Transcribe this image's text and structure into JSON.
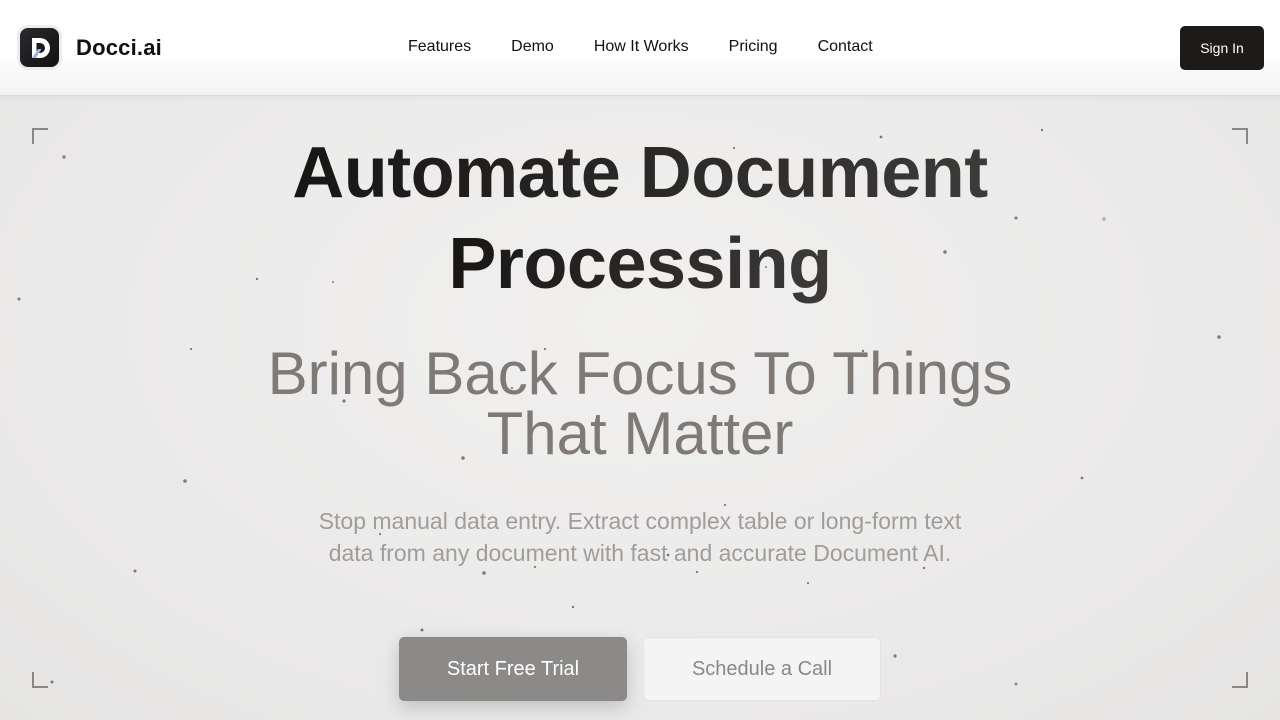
{
  "brand": {
    "name": "Docci.ai",
    "logo_icon": "docci-d-logo-icon"
  },
  "nav": {
    "items": [
      {
        "label": "Features"
      },
      {
        "label": "Demo"
      },
      {
        "label": "How It Works"
      },
      {
        "label": "Pricing"
      },
      {
        "label": "Contact"
      }
    ],
    "signin_label": "Sign In"
  },
  "hero": {
    "headline_line1": "Automate Document",
    "headline_line2": "Processing",
    "subhead_line1": "Bring Back Focus To Things",
    "subhead_line2": "That Matter",
    "desc_line1": "Stop manual data entry. Extract complex table or long-form text",
    "desc_line2": "data from any document with fast and accurate Document AI.",
    "primary_cta": "Start Free Trial",
    "secondary_cta": "Schedule a Call"
  },
  "colors": {
    "signin_bg": "#1d1a18",
    "primary_cta_bg": "#8c8a88",
    "subhead": "#7f7a75",
    "desc": "#a19c98"
  }
}
